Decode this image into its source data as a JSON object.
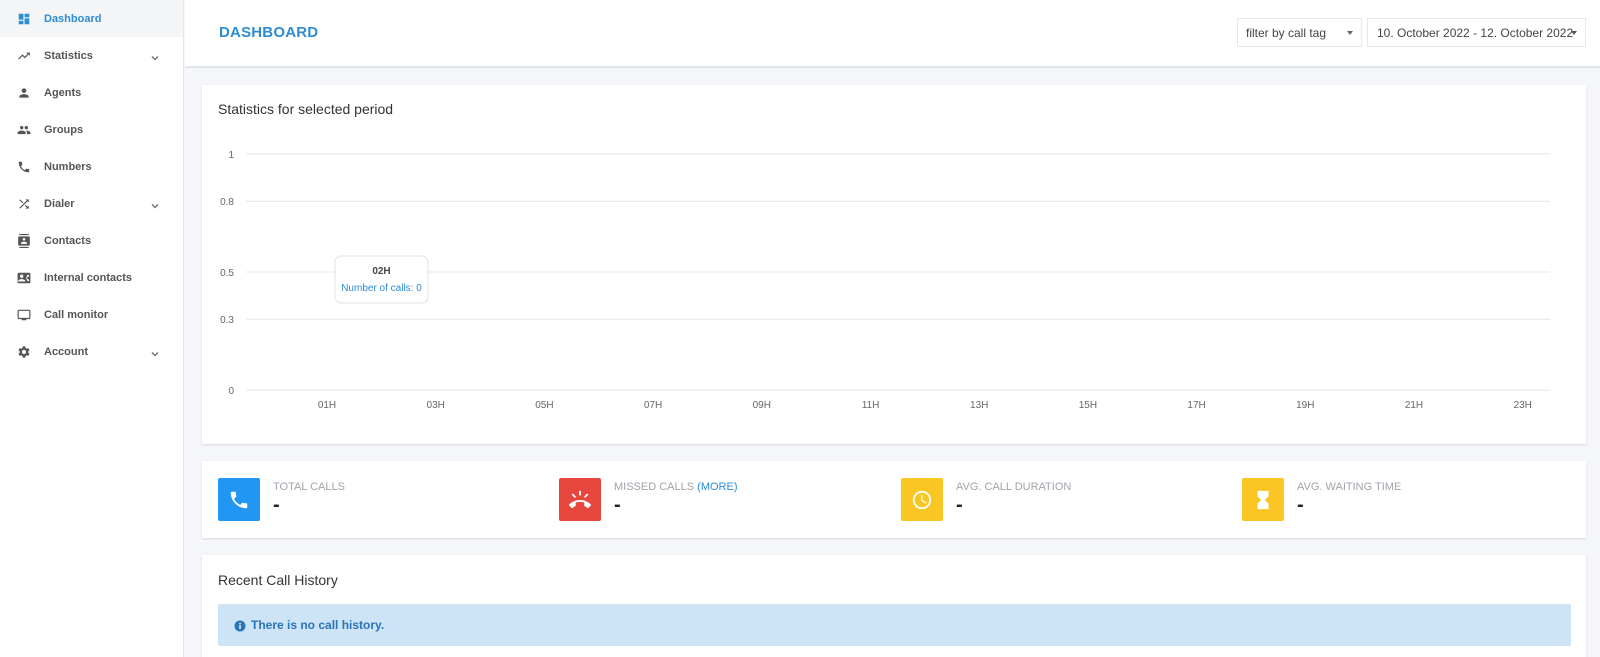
{
  "sidebar": {
    "items": [
      {
        "label": "Dashboard",
        "icon": "dashboard-icon",
        "active": true,
        "expandable": false
      },
      {
        "label": "Statistics",
        "icon": "trending-up-icon",
        "active": false,
        "expandable": true
      },
      {
        "label": "Agents",
        "icon": "person-icon",
        "active": false,
        "expandable": false
      },
      {
        "label": "Groups",
        "icon": "people-icon",
        "active": false,
        "expandable": false
      },
      {
        "label": "Numbers",
        "icon": "phone-icon",
        "active": false,
        "expandable": false
      },
      {
        "label": "Dialer",
        "icon": "shuffle-icon",
        "active": false,
        "expandable": true
      },
      {
        "label": "Contacts",
        "icon": "contacts-icon",
        "active": false,
        "expandable": false
      },
      {
        "label": "Internal contacts",
        "icon": "contact-card-icon",
        "active": false,
        "expandable": false
      },
      {
        "label": "Call monitor",
        "icon": "monitor-icon",
        "active": false,
        "expandable": false
      },
      {
        "label": "Account",
        "icon": "gear-icon",
        "active": false,
        "expandable": true
      }
    ]
  },
  "header": {
    "title": "DASHBOARD",
    "tag_filter": "filter by call tag",
    "date_range": "10. October 2022 - 12. October 2022"
  },
  "chart_card": {
    "title": "Statistics for selected period"
  },
  "chart_data": {
    "type": "line",
    "x": [
      "01H",
      "03H",
      "05H",
      "07H",
      "09H",
      "11H",
      "13H",
      "15H",
      "17H",
      "19H",
      "21H",
      "23H"
    ],
    "yticks": [
      0,
      0.3,
      0.5,
      0.8,
      1
    ],
    "ylim": [
      0,
      1
    ],
    "grid": true,
    "tooltip": {
      "x": "02H",
      "label": "Number of calls: 0"
    }
  },
  "stats": [
    {
      "label": "TOTAL CALLS",
      "more": "",
      "value": "-",
      "icon": "phone-icon",
      "color": "#2196f3"
    },
    {
      "label": "MISSED CALLS",
      "more": "(MORE)",
      "value": "-",
      "icon": "missed-call-icon",
      "color": "#e8473d"
    },
    {
      "label": "AVG. CALL DURATION",
      "more": "",
      "value": "-",
      "icon": "clock-icon",
      "color": "#f9c623"
    },
    {
      "label": "AVG. WAITING TIME",
      "more": "",
      "value": "-",
      "icon": "hourglass-icon",
      "color": "#f9c623"
    }
  ],
  "history": {
    "title": "Recent Call History",
    "empty_message": "There is no call history.",
    "info_icon": "info-icon"
  }
}
